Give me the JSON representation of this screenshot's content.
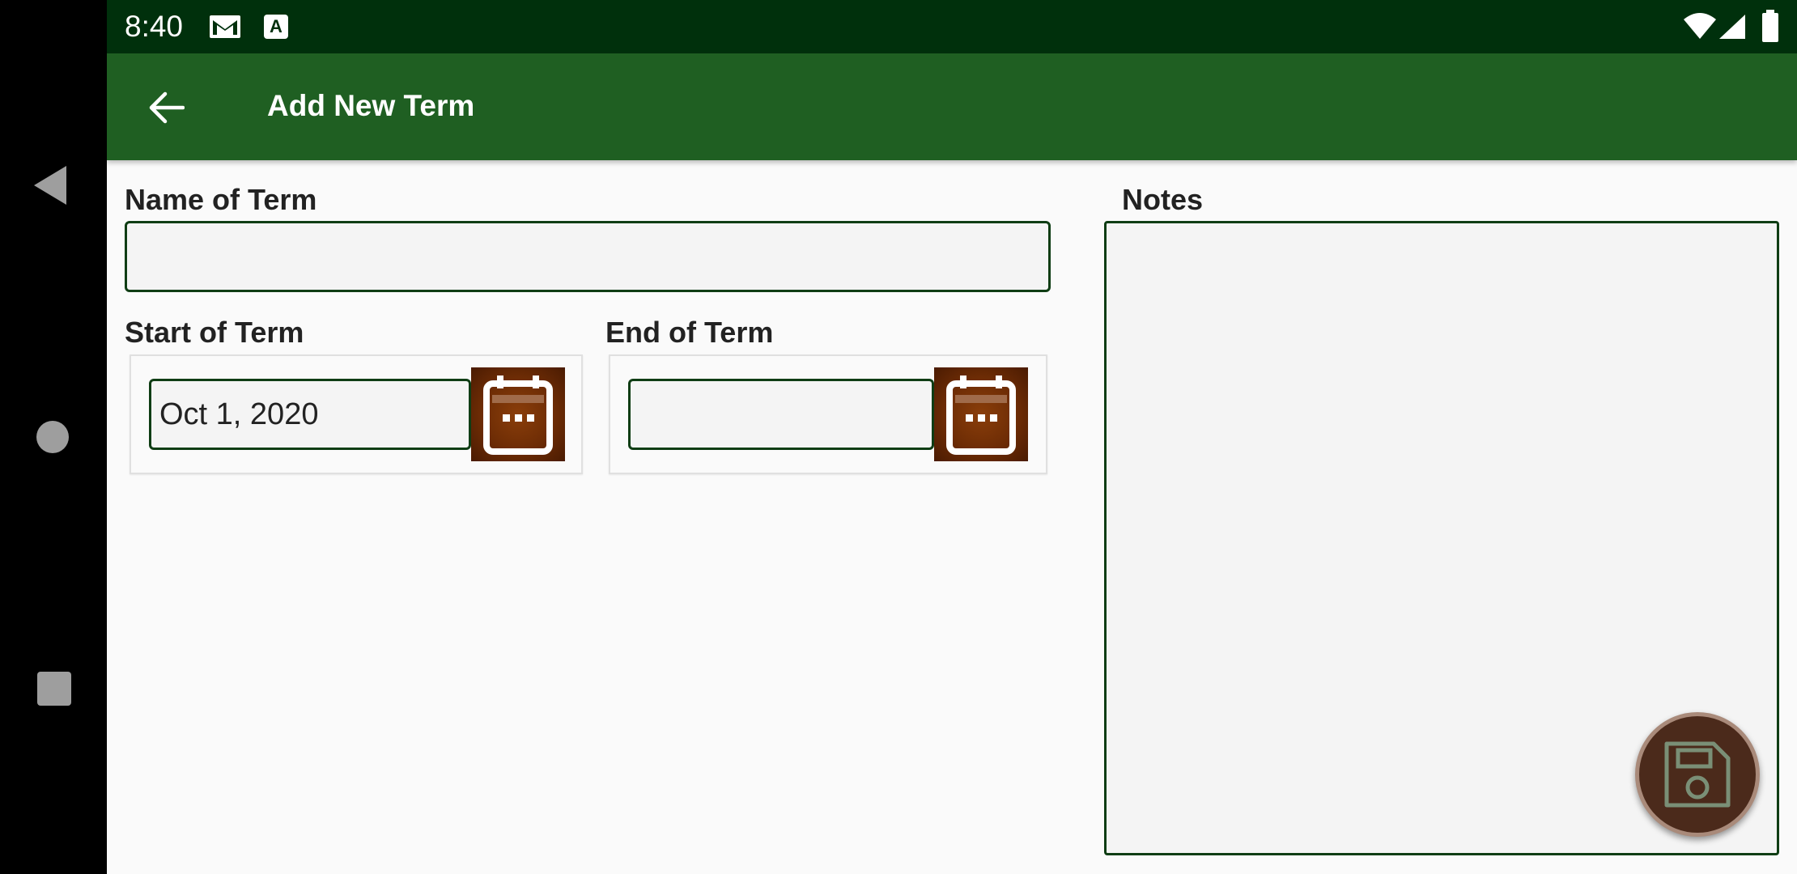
{
  "status_bar": {
    "time": "8:40",
    "icons": [
      "gmail-icon",
      "a-notification-icon",
      "wifi-icon",
      "signal-icon",
      "battery-icon"
    ]
  },
  "app_bar": {
    "title": "Add New Term",
    "background": "#1f5f22"
  },
  "form": {
    "name": {
      "label": "Name of Term",
      "value": ""
    },
    "start": {
      "label": "Start of Term",
      "value": "Oct 1, 2020"
    },
    "end": {
      "label": "End of Term",
      "value": ""
    },
    "notes": {
      "label": "Notes",
      "value": ""
    }
  },
  "fab": {
    "icon": "save-icon"
  },
  "nav": {
    "icons": [
      "back-icon",
      "home-icon",
      "recents-icon"
    ]
  },
  "colors": {
    "status_bar": "#00300c",
    "accent": "#1f5f22",
    "calendar_button": "#6d2c05",
    "fab": "#4b2a1b"
  }
}
